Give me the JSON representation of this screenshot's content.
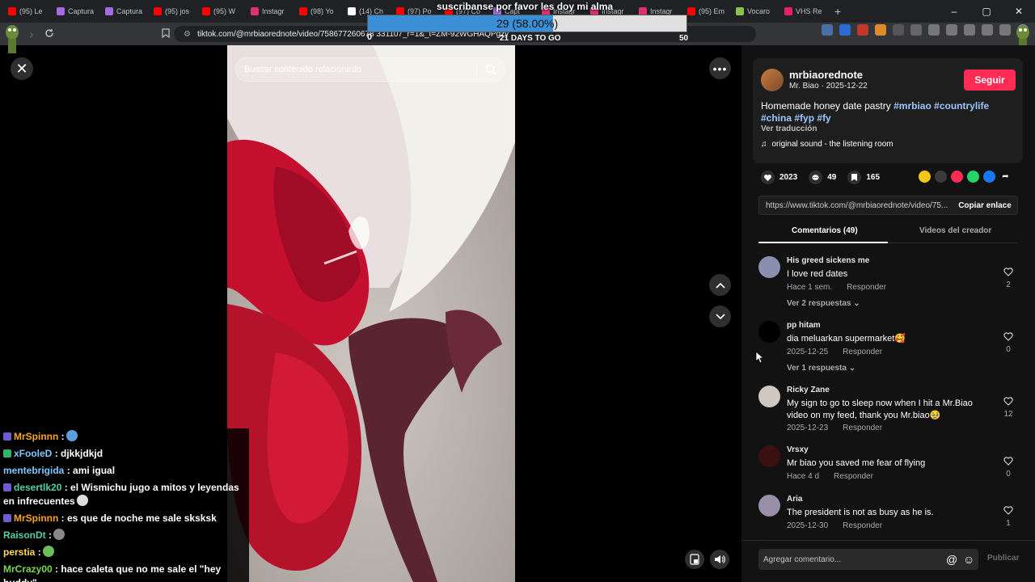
{
  "browser": {
    "tabs": [
      {
        "label": "(95) Le",
        "color": "#ff0000"
      },
      {
        "label": "Captura",
        "color": "#a36be0"
      },
      {
        "label": "Captura",
        "color": "#a36be0"
      },
      {
        "label": "(95) jos",
        "color": "#ff0000"
      },
      {
        "label": "(95) W",
        "color": "#ff0000"
      },
      {
        "label": "Instagr",
        "color": "#e1306c"
      },
      {
        "label": "(98) Yo",
        "color": "#ff0000"
      },
      {
        "label": "(14) Ch",
        "color": "#ffffff"
      },
      {
        "label": "(97) Po",
        "color": "#ff0000"
      },
      {
        "label": "(97) Co",
        "color": "#ff0000"
      },
      {
        "label": "Capt",
        "color": "#a36be0"
      },
      {
        "label": "Instagr",
        "color": "#e1306c"
      },
      {
        "label": "Instagr",
        "color": "#e1306c"
      },
      {
        "label": "Instagr",
        "color": "#e1306c"
      },
      {
        "label": "(95) Em",
        "color": "#ff0000"
      },
      {
        "label": "Vocaro",
        "color": "#8bc34a"
      },
      {
        "label": "VHS Re",
        "color": "#e91e63"
      }
    ],
    "new_tab": "+",
    "window_controls": [
      "–",
      "▢",
      "✕"
    ],
    "url": "tiktok.com/@mrbiaorednote/video/758677260678 331107_r=1&_t=ZM-92WGHAQPgzy"
  },
  "overlay": {
    "title": "suscribanse por favor les doy mi alma",
    "goal_text": "29 (58.00%)",
    "goal_fraction": 0.58,
    "goal_min": "0",
    "goal_max": "50",
    "days_left": "21 DAYS TO GO"
  },
  "video": {
    "close": "✕",
    "search_placeholder": "Buscar contenido relacionado",
    "more": "•••"
  },
  "chat": [
    {
      "user": "MrSpinnn",
      "color": "#f5a623",
      "badge": "purple",
      "text": ":",
      "emote": "#5aa0e0"
    },
    {
      "user": "xFooleD",
      "color": "#7ec8ff",
      "badge": "green",
      "text": ": djkkjdkjd"
    },
    {
      "user": "mentebrigida",
      "color": "#7ec8ff",
      "badge": "",
      "text": ": ami igual"
    },
    {
      "user": "desertlk20",
      "color": "#4fd1a5",
      "badge": "purple",
      "text": ": el Wismichu jugo a mitos y leyendas en infrecuentes",
      "emote": "#dddddd"
    },
    {
      "user": "MrSpinnn",
      "color": "#f5a623",
      "badge": "purple",
      "text": ": es que de noche me sale sksksk"
    },
    {
      "user": "RaisonDt",
      "color": "#4fd1a5",
      "badge": "",
      "text": ":",
      "emote": "#888888"
    },
    {
      "user": "perstia",
      "color": "#ffd84d",
      "badge": "",
      "text": ":",
      "emote": "#6bbf59"
    },
    {
      "user": "MrCrazy00",
      "color": "#7bd64b",
      "badge": "",
      "text": ": hace caleta que no me sale el \"hey buddy\""
    }
  ],
  "profile": {
    "username": "mrbiaorednote",
    "subline": "Mr. Biao · 2025-12-22",
    "follow_label": "Seguir",
    "desc_text": "Homemade honey date pastry",
    "hashtags": [
      "#mrbiao",
      "#countrylife",
      "#china",
      "#fyp",
      "#fy"
    ],
    "translate_label": "Ver traducción",
    "sound": "original sound - the listening room",
    "likes": "2023",
    "comments_count": "49",
    "saves": "165",
    "link": "https://www.tiktok.com/@mrbiaorednote/video/75...",
    "copy_label": "Copiar enlace",
    "tab_comments": "Comentarios (49)",
    "tab_videos": "Videos del creador",
    "share_colors": [
      "#f5c518",
      "#3a3a3a",
      "#fe2c55",
      "#25d366",
      "#1877f2"
    ]
  },
  "comments": [
    {
      "user": "His greed sickens me",
      "text": "I love red dates",
      "time": "Hace 1 sem.",
      "reply": "Responder",
      "likes": "2",
      "replies": "Ver 2 respuestas ⌄",
      "avatar": "#8a8fb0"
    },
    {
      "user": "pp hitam",
      "text": "dia meluarkan supermarket🥰",
      "time": "2025-12-25",
      "reply": "Responder",
      "likes": "0",
      "replies": "Ver 1 respuesta ⌄",
      "avatar": "#000000"
    },
    {
      "user": "Ricky Zane",
      "text": "My sign to go to sleep now when I hit a Mr.Biao video on my feed, thank you Mr.biao🥹",
      "time": "2025-12-23",
      "reply": "Responder",
      "likes": "12",
      "replies": "",
      "avatar": "#d0c8c0"
    },
    {
      "user": "Vrsxy",
      "text": "Mr biao you saved me fear of flying",
      "time": "Hace 4 d",
      "reply": "Responder",
      "likes": "0",
      "replies": "",
      "avatar": "#3a1010"
    },
    {
      "user": "Aria",
      "text": "The president is not as busy as he is.",
      "time": "2025-12-30",
      "reply": "Responder",
      "likes": "1",
      "replies": "",
      "avatar": "#9a8fa8"
    }
  ],
  "add_comment": {
    "placeholder": "Agregar comentario...",
    "publish": "Publicar"
  }
}
